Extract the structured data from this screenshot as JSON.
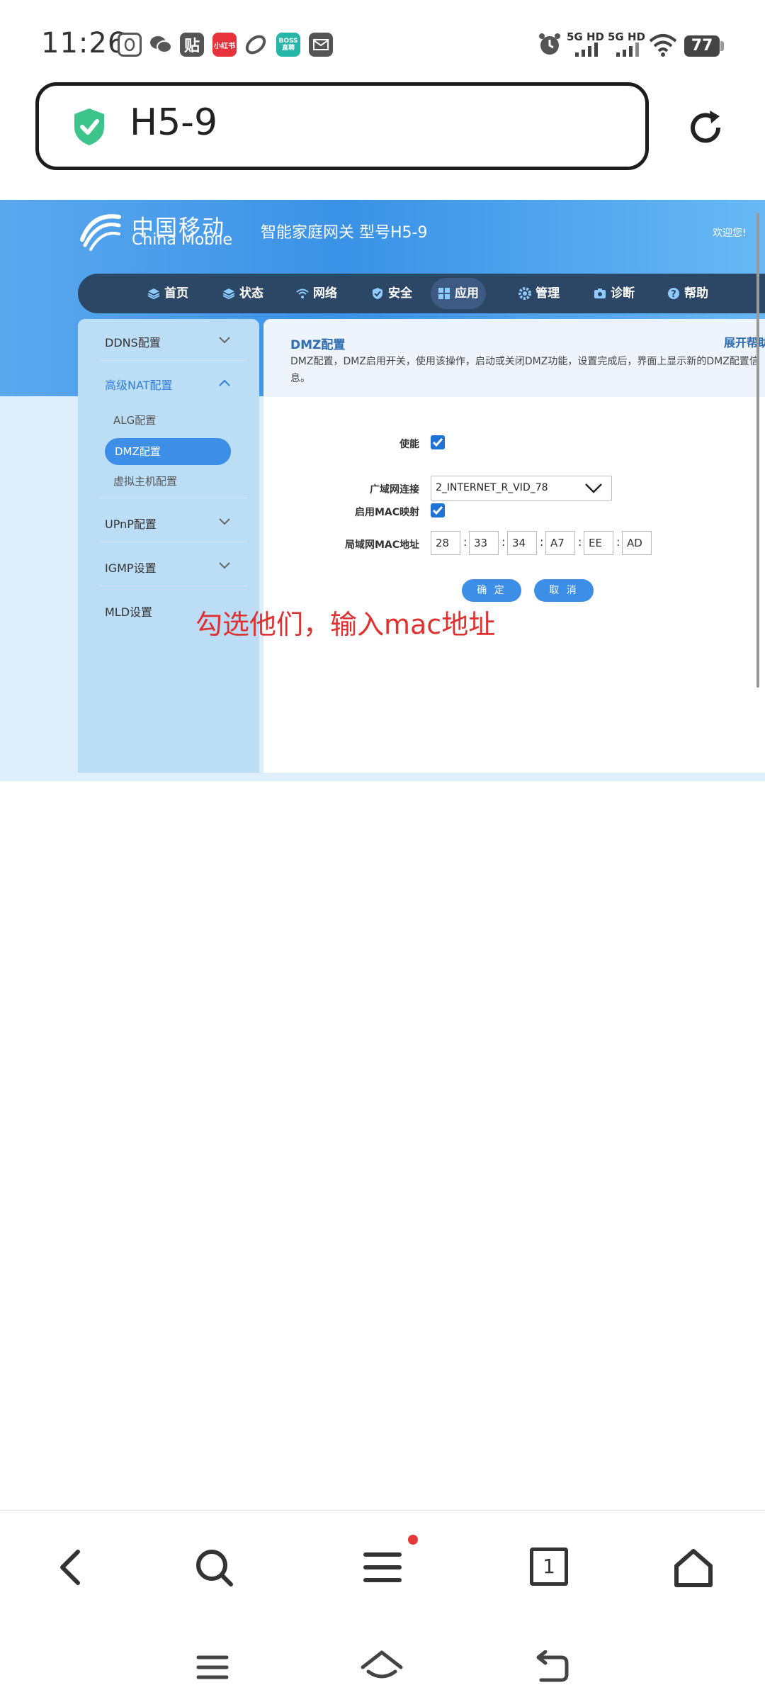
{
  "status_bar": {
    "time": "11:26",
    "apps": [
      "QQ",
      "WeChat",
      "贴",
      "小红书",
      "Link",
      "BOSS直聘",
      "Mail"
    ],
    "app_badges": {
      "tieba": "贴",
      "xiaohongshu": "小红书",
      "boss_top": "BOSS",
      "boss_bottom": "直聘"
    },
    "signal1": "5G HD",
    "signal2": "5G HD",
    "battery": "77"
  },
  "browser": {
    "address": "H5-9"
  },
  "router": {
    "brand_cn": "中国移动",
    "brand_en": "China Mobile",
    "gateway_title": "智能家庭网关 型号H5-9",
    "welcome": "欢迎您!",
    "nav": [
      {
        "label": "首页",
        "icon": "layers-icon"
      },
      {
        "label": "状态",
        "icon": "layers-icon"
      },
      {
        "label": "网络",
        "icon": "wifi-icon"
      },
      {
        "label": "安全",
        "icon": "shield-icon"
      },
      {
        "label": "应用",
        "icon": "grid-icon",
        "active": true
      },
      {
        "label": "管理",
        "icon": "gear-icon"
      },
      {
        "label": "诊断",
        "icon": "camera-icon"
      },
      {
        "label": "帮助",
        "icon": "help-icon"
      }
    ],
    "sidebar": {
      "ddns": "DDNS配置",
      "nat": "高级NAT配置",
      "alg": "ALG配置",
      "dmz": "DMZ配置",
      "virtual_host": "虚拟主机配置",
      "upnp": "UPnP配置",
      "igmp": "IGMP设置",
      "mld": "MLD设置"
    },
    "panel": {
      "title": "DMZ配置",
      "help": "展开帮助",
      "desc": "DMZ配置，DMZ启用开关，使用该操作，启动或关闭DMZ功能，设置完成后，界面上显示新的DMZ配置信息。",
      "enable_label": "使能",
      "enable_checked": true,
      "wan_label": "广域网连接",
      "wan_value": "2_INTERNET_R_VID_78",
      "mac_map_label": "启用MAC映射",
      "mac_map_checked": true,
      "mac_label": "局域网MAC地址",
      "mac": [
        "28",
        "33",
        "34",
        "A7",
        "EE",
        "AD"
      ],
      "mac_sep": ":",
      "ok": "确 定",
      "cancel": "取 消"
    },
    "annotation": "勾选他们，输入mac地址"
  },
  "toolbar": {
    "tab_count": "1"
  }
}
